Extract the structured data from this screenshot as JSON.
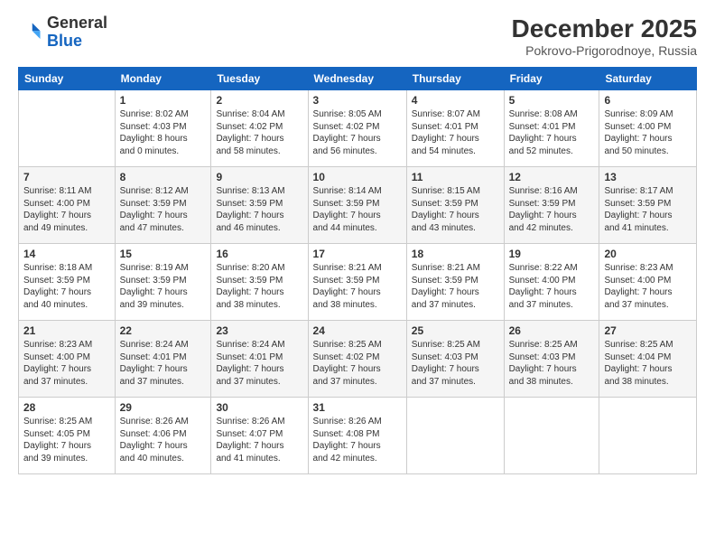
{
  "logo": {
    "general": "General",
    "blue": "Blue"
  },
  "header": {
    "month": "December 2025",
    "location": "Pokrovo-Prigorodnoye, Russia"
  },
  "days_of_week": [
    "Sunday",
    "Monday",
    "Tuesday",
    "Wednesday",
    "Thursday",
    "Friday",
    "Saturday"
  ],
  "weeks": [
    [
      {
        "day": "",
        "info": ""
      },
      {
        "day": "1",
        "info": "Sunrise: 8:02 AM\nSunset: 4:03 PM\nDaylight: 8 hours\nand 0 minutes."
      },
      {
        "day": "2",
        "info": "Sunrise: 8:04 AM\nSunset: 4:02 PM\nDaylight: 7 hours\nand 58 minutes."
      },
      {
        "day": "3",
        "info": "Sunrise: 8:05 AM\nSunset: 4:02 PM\nDaylight: 7 hours\nand 56 minutes."
      },
      {
        "day": "4",
        "info": "Sunrise: 8:07 AM\nSunset: 4:01 PM\nDaylight: 7 hours\nand 54 minutes."
      },
      {
        "day": "5",
        "info": "Sunrise: 8:08 AM\nSunset: 4:01 PM\nDaylight: 7 hours\nand 52 minutes."
      },
      {
        "day": "6",
        "info": "Sunrise: 8:09 AM\nSunset: 4:00 PM\nDaylight: 7 hours\nand 50 minutes."
      }
    ],
    [
      {
        "day": "7",
        "info": "Sunrise: 8:11 AM\nSunset: 4:00 PM\nDaylight: 7 hours\nand 49 minutes."
      },
      {
        "day": "8",
        "info": "Sunrise: 8:12 AM\nSunset: 3:59 PM\nDaylight: 7 hours\nand 47 minutes."
      },
      {
        "day": "9",
        "info": "Sunrise: 8:13 AM\nSunset: 3:59 PM\nDaylight: 7 hours\nand 46 minutes."
      },
      {
        "day": "10",
        "info": "Sunrise: 8:14 AM\nSunset: 3:59 PM\nDaylight: 7 hours\nand 44 minutes."
      },
      {
        "day": "11",
        "info": "Sunrise: 8:15 AM\nSunset: 3:59 PM\nDaylight: 7 hours\nand 43 minutes."
      },
      {
        "day": "12",
        "info": "Sunrise: 8:16 AM\nSunset: 3:59 PM\nDaylight: 7 hours\nand 42 minutes."
      },
      {
        "day": "13",
        "info": "Sunrise: 8:17 AM\nSunset: 3:59 PM\nDaylight: 7 hours\nand 41 minutes."
      }
    ],
    [
      {
        "day": "14",
        "info": "Sunrise: 8:18 AM\nSunset: 3:59 PM\nDaylight: 7 hours\nand 40 minutes."
      },
      {
        "day": "15",
        "info": "Sunrise: 8:19 AM\nSunset: 3:59 PM\nDaylight: 7 hours\nand 39 minutes."
      },
      {
        "day": "16",
        "info": "Sunrise: 8:20 AM\nSunset: 3:59 PM\nDaylight: 7 hours\nand 38 minutes."
      },
      {
        "day": "17",
        "info": "Sunrise: 8:21 AM\nSunset: 3:59 PM\nDaylight: 7 hours\nand 38 minutes."
      },
      {
        "day": "18",
        "info": "Sunrise: 8:21 AM\nSunset: 3:59 PM\nDaylight: 7 hours\nand 37 minutes."
      },
      {
        "day": "19",
        "info": "Sunrise: 8:22 AM\nSunset: 4:00 PM\nDaylight: 7 hours\nand 37 minutes."
      },
      {
        "day": "20",
        "info": "Sunrise: 8:23 AM\nSunset: 4:00 PM\nDaylight: 7 hours\nand 37 minutes."
      }
    ],
    [
      {
        "day": "21",
        "info": "Sunrise: 8:23 AM\nSunset: 4:00 PM\nDaylight: 7 hours\nand 37 minutes."
      },
      {
        "day": "22",
        "info": "Sunrise: 8:24 AM\nSunset: 4:01 PM\nDaylight: 7 hours\nand 37 minutes."
      },
      {
        "day": "23",
        "info": "Sunrise: 8:24 AM\nSunset: 4:01 PM\nDaylight: 7 hours\nand 37 minutes."
      },
      {
        "day": "24",
        "info": "Sunrise: 8:25 AM\nSunset: 4:02 PM\nDaylight: 7 hours\nand 37 minutes."
      },
      {
        "day": "25",
        "info": "Sunrise: 8:25 AM\nSunset: 4:03 PM\nDaylight: 7 hours\nand 37 minutes."
      },
      {
        "day": "26",
        "info": "Sunrise: 8:25 AM\nSunset: 4:03 PM\nDaylight: 7 hours\nand 38 minutes."
      },
      {
        "day": "27",
        "info": "Sunrise: 8:25 AM\nSunset: 4:04 PM\nDaylight: 7 hours\nand 38 minutes."
      }
    ],
    [
      {
        "day": "28",
        "info": "Sunrise: 8:25 AM\nSunset: 4:05 PM\nDaylight: 7 hours\nand 39 minutes."
      },
      {
        "day": "29",
        "info": "Sunrise: 8:26 AM\nSunset: 4:06 PM\nDaylight: 7 hours\nand 40 minutes."
      },
      {
        "day": "30",
        "info": "Sunrise: 8:26 AM\nSunset: 4:07 PM\nDaylight: 7 hours\nand 41 minutes."
      },
      {
        "day": "31",
        "info": "Sunrise: 8:26 AM\nSunset: 4:08 PM\nDaylight: 7 hours\nand 42 minutes."
      },
      {
        "day": "",
        "info": ""
      },
      {
        "day": "",
        "info": ""
      },
      {
        "day": "",
        "info": ""
      }
    ]
  ]
}
